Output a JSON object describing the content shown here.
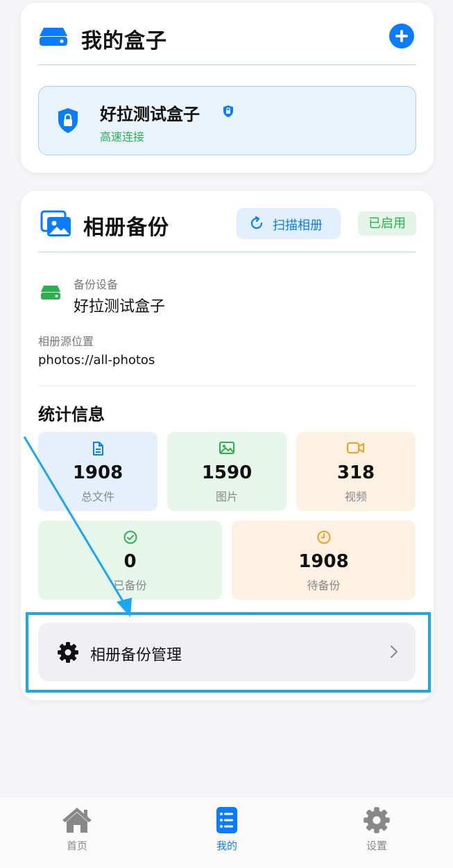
{
  "my_boxes": {
    "title": "我的盒子",
    "device": {
      "name": "好拉测试盒子",
      "status": "高速连接"
    }
  },
  "album_backup": {
    "title": "相册备份",
    "scan_button": "扫描相册",
    "enabled_badge": "已启用",
    "backup_device_label": "备份设备",
    "backup_device_name": "好拉测试盒子",
    "source_label": "相册源位置",
    "source_value": "photos://all-photos",
    "stats_title": "统计信息",
    "stats": {
      "total": {
        "value": "1908",
        "label": "总文件"
      },
      "images": {
        "value": "1590",
        "label": "图片"
      },
      "videos": {
        "value": "318",
        "label": "视频"
      },
      "backed_up": {
        "value": "0",
        "label": "已备份"
      },
      "pending": {
        "value": "1908",
        "label": "待备份"
      }
    },
    "manage_button": "相册备份管理"
  },
  "tabbar": {
    "home": "首页",
    "mine": "我的",
    "settings": "设置"
  },
  "colors": {
    "accent": "#0a7cff",
    "success": "#2bb04f",
    "warning": "#f0a020",
    "highlight": "#1aa6f5"
  },
  "icons": [
    "drive-icon",
    "add-icon",
    "shield-lock-icon",
    "lock-badge-icon",
    "photos-icon",
    "refresh-icon",
    "document-icon",
    "image-icon",
    "video-icon",
    "check-circle-icon",
    "clock-icon",
    "gear-icon",
    "chevron-right-icon",
    "home-icon",
    "list-icon",
    "settings-gear-icon"
  ]
}
